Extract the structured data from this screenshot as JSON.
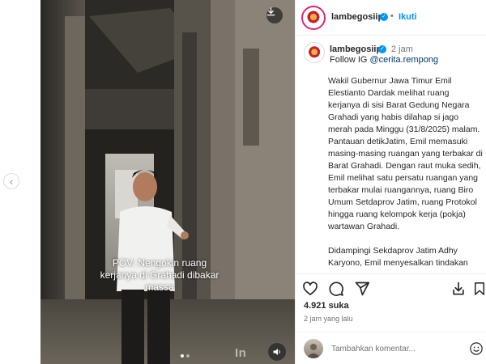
{
  "post": {
    "media": {
      "caption_overlay": "POV: Nengokin ruang kerjanya di Grahadi dibakar massa",
      "watermark": "In",
      "carousel_count": 2,
      "carousel_active": 1
    },
    "header": {
      "username": "lambegosiip",
      "separator": "•",
      "follow_label": "Ikuti"
    },
    "caption": {
      "username": "lambegosiip",
      "time": "2 jam",
      "follow_prefix": "Follow IG ",
      "mention": "@cerita.rempong",
      "paragraphs": [
        "Wakil Gubernur Jawa Timur Emil Elestianto Dardak melihat ruang kerjanya di sisi Barat Gedung Negara Grahadi yang habis dilahap si jago merah pada Minggu (31/8/2025) malam.",
        "Pantauan detikJatim, Emil memasuki masing-masing ruangan yang terbakar di Barat Grahadi. Dengan raut muka sedih, Emil melihat satu persatu ruangan yang terbakar mulai ruangannya, ruang Biro Umum Setdaprov Jatim, ruang Protokol hingga ruang kelompok kerja (pokja) wartawan Grahadi.",
        "Didampingi Sekdaprov Jatim Adhy Karyono, Emil menyesalkan tindakan"
      ]
    },
    "likes_text": "4.921 suka",
    "posted_text": "2 jam yang lalu",
    "comment": {
      "placeholder": "Tambahkan komentar..."
    }
  },
  "icons": {
    "prev": "chevron-left-icon",
    "download": "download-icon",
    "sound": "speaker-icon",
    "like": "heart-icon",
    "comment": "comment-icon",
    "share": "share-icon",
    "save": "bookmark-icon",
    "emoji": "emoji-icon"
  },
  "colors": {
    "accent": "#0095f6",
    "story_ring": "#d62976",
    "mention": "#00376b"
  }
}
